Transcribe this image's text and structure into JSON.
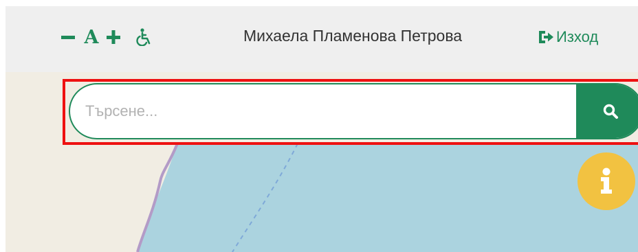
{
  "header": {
    "accessibility": {
      "decrease_font_label": "Намали шрифта",
      "font_glyph": "A",
      "increase_font_label": "Увеличи шрифта",
      "accessibility_label": "Достъпност"
    },
    "user_name": "Михаела Пламенова Петрова",
    "logout_label": "Изход"
  },
  "search": {
    "placeholder": "Търсене...",
    "value": "",
    "button_icon": "search-icon"
  },
  "info_button": {
    "icon": "info-icon"
  },
  "colors": {
    "accent_green": "#1f8a5a",
    "header_bg": "#efefef",
    "info_yellow": "#f2c241",
    "highlight_red": "#ee1111",
    "map_land": "#f1ede3",
    "map_water": "#abd3df",
    "map_border": "#b39bc7"
  }
}
